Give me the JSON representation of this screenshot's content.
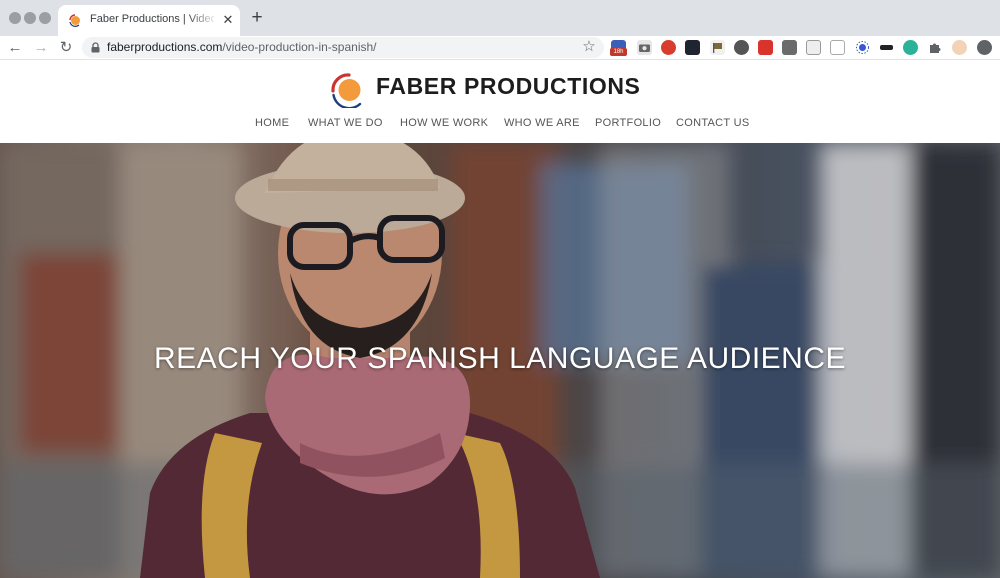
{
  "browser": {
    "tab": {
      "title": "Faber Productions | Video Production in Spanish",
      "close_glyph": "✕"
    },
    "new_tab_glyph": "+",
    "nav": {
      "back_glyph": "←",
      "forward_glyph": "→",
      "reload_glyph": "↻"
    },
    "url": {
      "domain": "faberproductions.com",
      "path": "/video-production-in-spanish/"
    },
    "bookmark_glyph": "☆",
    "extension_badge": "18h",
    "colors": {
      "chrome_bg": "#dee1e6",
      "omnibox_bg": "#f1f3f4"
    }
  },
  "site": {
    "logo_text": "FABER PRODUCTIONS",
    "nav": [
      "HOME",
      "WHAT WE DO",
      "HOW WE WORK",
      "WHO WE ARE",
      "PORTFOLIO",
      "CONTACT US"
    ],
    "colors": {
      "logo_orange": "#f39a3c",
      "logo_red": "#c8342e",
      "logo_blue": "#1e3d7b"
    }
  },
  "hero": {
    "heading": "REACH YOUR SPANISH LANGUAGE AUDIENCE",
    "image": "photo-man-with-hat-glasses-scarf"
  }
}
